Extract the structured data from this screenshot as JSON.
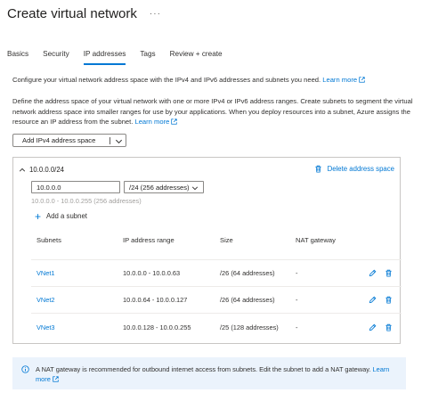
{
  "header": {
    "title": "Create virtual network"
  },
  "tabs": [
    {
      "label": "Basics"
    },
    {
      "label": "Security"
    },
    {
      "label": "IP addresses",
      "active": true
    },
    {
      "label": "Tags"
    },
    {
      "label": "Review + create"
    }
  ],
  "intro": {
    "text": "Configure your virtual network address space with the IPv4 and IPv6 addresses and subnets you need.",
    "learn_more": "Learn more"
  },
  "define": {
    "text": "Define the address space of your virtual network with one or more IPv4 or IPv6 address ranges. Create subnets to segment the virtual network address space into smaller ranges for use by your applications. When you deploy resources into a subnet, Azure assigns the resource an IP address from the subnet.",
    "learn_more": "Learn more"
  },
  "add_address_space": {
    "label": "Add IPv4 address space"
  },
  "address_space": {
    "header": "10.0.0.0/24",
    "delete_label": "Delete address space",
    "ip_value": "10.0.0.0",
    "prefix_value": "/24 (256 addresses)",
    "range_hint": "10.0.0.0 - 10.0.0.255 (256 addresses)",
    "add_subnet_label": "Add a subnet"
  },
  "subnet_table": {
    "columns": [
      "Subnets",
      "IP address range",
      "Size",
      "NAT gateway"
    ],
    "rows": [
      {
        "name": "VNet1",
        "range": "10.0.0.0 - 10.0.0.63",
        "size": "/26 (64 addresses)",
        "nat": "-"
      },
      {
        "name": "VNet2",
        "range": "10.0.0.64 - 10.0.0.127",
        "size": "/26 (64 addresses)",
        "nat": "-"
      },
      {
        "name": "VNet3",
        "range": "10.0.0.128 - 10.0.0.255",
        "size": "/25 (128 addresses)",
        "nat": "-"
      }
    ]
  },
  "info": {
    "text": "A NAT gateway is recommended for outbound internet access from subnets. Edit the subnet to add a NAT gateway.",
    "learn_more": "Learn more"
  },
  "colors": {
    "accent": "#0078d4",
    "info_bg": "#ebf3fc",
    "border": "#c8c6c4"
  },
  "icons": [
    "more-icon",
    "chevron-down-icon",
    "chevron-up-icon",
    "trash-icon",
    "plus-icon",
    "edit-icon",
    "info-icon",
    "external-link-icon"
  ]
}
